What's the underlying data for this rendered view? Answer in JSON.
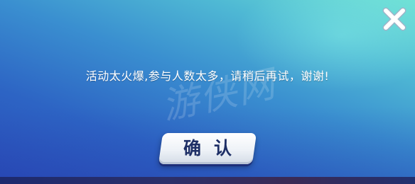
{
  "dialog": {
    "message": "活动太火爆,参与人数太多，请稍后再试，谢谢!",
    "watermark": "游侠网",
    "confirm_label": "确认",
    "close_icon": "close-icon"
  },
  "colors": {
    "gradient_top_right": "#6fe1d5",
    "gradient_bottom_left": "#2a4db8",
    "button_text": "#1e2f66",
    "text": "#ffffff"
  }
}
